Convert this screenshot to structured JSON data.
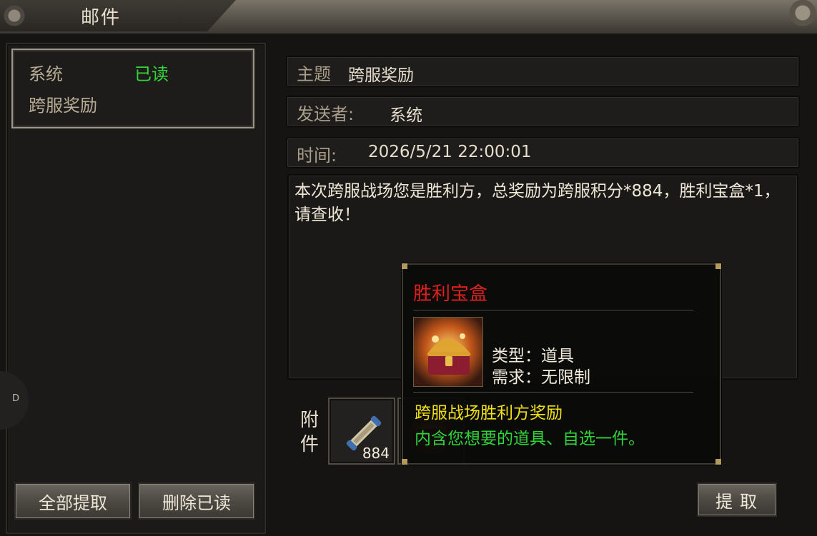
{
  "window": {
    "title": "邮件"
  },
  "sidebar": {
    "side_tab_label": "D",
    "mail_list": [
      {
        "sender": "系统",
        "status": "已读",
        "subject": "跨服奖励"
      }
    ],
    "buttons": {
      "claim_all": "全部提取",
      "delete_read": "删除已读"
    }
  },
  "detail": {
    "subject_label": "主题",
    "subject": "跨服奖励",
    "sender_label": "发送者:",
    "sender": "系统",
    "time_label": "时间:",
    "time": "2026/5/21 22:00:01",
    "body": "本次跨服战场您是胜利方，总奖励为跨服积分*884，胜利宝盒*1，请查收！",
    "attachment_label": "附件",
    "attachments": [
      {
        "icon": "scroll-icon",
        "count": "884"
      },
      {
        "icon": "treasure-chest-icon",
        "count": ""
      }
    ],
    "claim_button": "提取"
  },
  "tooltip": {
    "item_name": "胜利宝盒",
    "icon": "treasure-chest-icon",
    "type_line": "类型：道具",
    "requirement_line": "需求：无限制",
    "description_title": "跨服战场胜利方奖励",
    "description": "内含您想要的道具、自选一件。"
  },
  "colors": {
    "status_read": "#33d43b",
    "item_name": "#e0201d",
    "desc_title": "#f0e018",
    "desc_body": "#30d43a"
  }
}
